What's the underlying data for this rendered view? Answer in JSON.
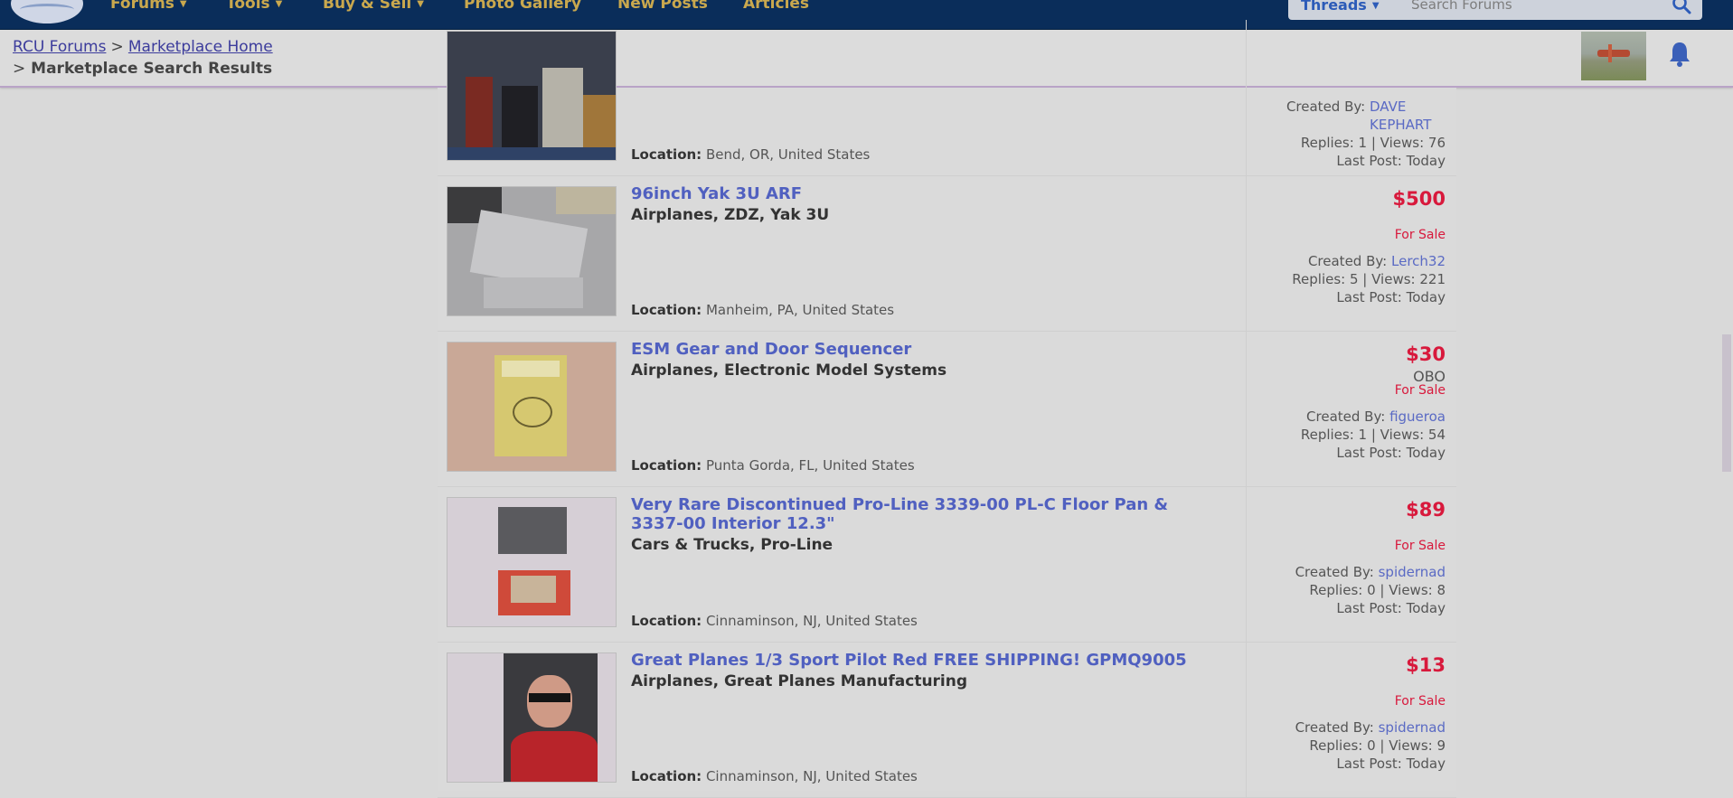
{
  "nav": {
    "items": [
      "Forums",
      "Tools",
      "Buy & Sell",
      "Photo Gallery",
      "New Posts",
      "Articles"
    ],
    "search_scope": "Threads",
    "search_placeholder": "Search Forums"
  },
  "breadcrumb": {
    "home": "RCU Forums",
    "sep": ">",
    "market": "Marketplace Home",
    "current": "Marketplace Search Results"
  },
  "listings": [
    {
      "title": "",
      "category": "",
      "location_label": "Location:",
      "location": "Bend, OR, United States",
      "price": "",
      "obo": "",
      "status": "",
      "created_label": "Created By:",
      "user": "DAVE KEPHART",
      "replies_views": "Replies: 1 | Views: 76",
      "last_post": "Last Post: Today"
    },
    {
      "title": "96inch Yak 3U ARF",
      "category": "Airplanes, ZDZ, Yak 3U",
      "location_label": "Location:",
      "location": "Manheim, PA, United States",
      "price": "$500",
      "obo": "",
      "status": "For Sale",
      "created_label": "Created By:",
      "user": "Lerch32",
      "replies_views": "Replies: 5 | Views: 221",
      "last_post": "Last Post: Today"
    },
    {
      "title": "ESM Gear and Door Sequencer",
      "category": "Airplanes, Electronic Model Systems",
      "location_label": "Location:",
      "location": "Punta Gorda, FL, United States",
      "price": "$30",
      "obo": "OBO",
      "status": "For Sale",
      "created_label": "Created By:",
      "user": "figueroa",
      "replies_views": "Replies: 1 | Views: 54",
      "last_post": "Last Post: Today"
    },
    {
      "title": "Very Rare Discontinued Pro-Line 3339-00 PL-C Floor Pan & 3337-00 Interior 12.3\"",
      "category": "Cars & Trucks, Pro-Line",
      "location_label": "Location:",
      "location": "Cinnaminson, NJ, United States",
      "price": "$89",
      "obo": "",
      "status": "For Sale",
      "created_label": "Created By:",
      "user": "spidernad",
      "replies_views": "Replies: 0 | Views: 8",
      "last_post": "Last Post: Today"
    },
    {
      "title": "Great Planes 1/3 Sport Pilot Red FREE SHIPPING! GPMQ9005",
      "category": "Airplanes, Great Planes Manufacturing",
      "location_label": "Location:",
      "location": "Cinnaminson, NJ, United States",
      "price": "$13",
      "obo": "",
      "status": "For Sale",
      "created_label": "Created By:",
      "user": "spidernad",
      "replies_views": "Replies: 0 | Views: 9",
      "last_post": "Last Post: Today"
    }
  ],
  "colors": {
    "nav_bg": "#0a2d5a",
    "nav_text": "#c9a84e",
    "price": "#d8193c",
    "link": "#5060c0"
  }
}
